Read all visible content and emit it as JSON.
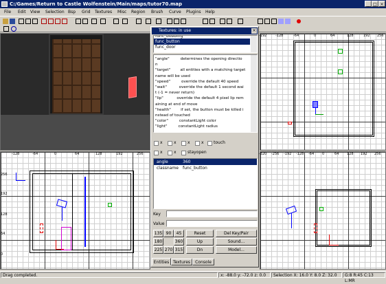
{
  "window": {
    "title": "C:/Games/Return to Castle Wolfenstein/Main/maps/tutor70.map"
  },
  "menu": [
    "File",
    "Edit",
    "View",
    "Selection",
    "Bsp",
    "Grid",
    "Textures",
    "Misc",
    "Region",
    "Brush",
    "Curve",
    "Plugins",
    "Help"
  ],
  "entity_dialog": {
    "title": "Textures: in use",
    "classes": [
      "func_bobbing",
      "func_button",
      "func_door"
    ],
    "selected_class": "func_button",
    "description": [
      "\"angle\"         determines the opening directio",
      "n",
      "\"target\"        all entities with a matching target",
      "name will be used",
      "\"speed\"         override the default 40 speed",
      "\"wait\"          override the default 1 second wai",
      "t (-1 = never return)",
      "\"lip\"           override the default 4 pixel lip rem",
      "aining at end of move",
      "\"health\"        if set, the button must be killed i",
      "nstead of touched",
      "\"color\"         constantLight color",
      "\"light\"         constantLight radius"
    ],
    "flags_row1": [
      "x",
      "x",
      "x",
      "x",
      "touch"
    ],
    "flags_row2": [
      "x",
      "x",
      "stayopen"
    ],
    "keyvalues": [
      {
        "key": "angle",
        "value": "360"
      },
      {
        "key": "classname",
        "value": "func_button"
      }
    ],
    "key_label": "Key",
    "value_label": "Value",
    "angle_buttons": [
      [
        "135",
        "90",
        "45"
      ],
      [
        "180",
        "",
        "360"
      ],
      [
        "225",
        "270",
        "315"
      ]
    ],
    "action_buttons": {
      "reset": "Reset",
      "up": "Up",
      "dn": "Dn",
      "del": "Del Key/Pair",
      "sound": "Sound...",
      "model": "Model..."
    },
    "tabs": [
      "Entities",
      "Textures",
      "Console"
    ]
  },
  "rulers": {
    "top_right": [
      "-192",
      "-128",
      "-64",
      "0",
      "64",
      "128",
      "192",
      "256"
    ],
    "bottom_left_top": [
      "-128",
      "-64",
      "0",
      "64",
      "128",
      "192",
      "256"
    ],
    "bottom_left_side": [
      "256",
      "192",
      "128",
      "64",
      "0"
    ],
    "bottom_right_top": [
      "-320",
      "-256",
      "-192",
      "-128",
      "-64",
      "0",
      "64",
      "128",
      "192",
      "256"
    ]
  },
  "status": {
    "message": "Drag completed.",
    "coords": "x: -88.0  y: -72.0  z: 0.0",
    "selection": "Selection X: 16.0  Y: 8.0  Z: 32.0",
    "grid": "G:8 R:45 C:13 L:MR"
  }
}
